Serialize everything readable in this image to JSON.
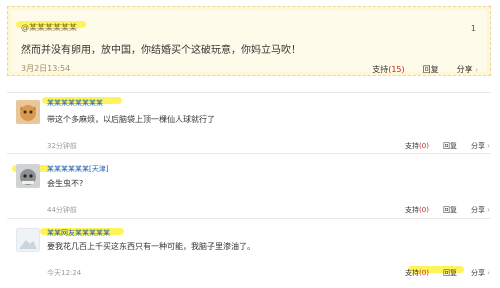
{
  "quote": {
    "author": "@某某某某某某",
    "number": "1",
    "text": "然而并没有卵用，放中国，你结婚买个这破玩意，你妈立马吹！",
    "time": "3月2日13:54",
    "actions": {
      "support": "支持",
      "support_count": "(15)",
      "reply": "回复",
      "share": "分享"
    }
  },
  "comments": [
    {
      "user": "某某某某某某某某",
      "text": "带这个多麻烦，以后脑袋上顶一棵仙人球就行了",
      "time": "32分钟前",
      "actions": {
        "support": "支持",
        "support_count": "(0)",
        "reply": "回复",
        "share": "分享"
      }
    },
    {
      "user": "某某某某某某[天津]",
      "text": "会生虫不?",
      "time": "44分钟前",
      "actions": {
        "support": "支持",
        "support_count": "(0)",
        "reply": "回复",
        "share": "分享"
      }
    },
    {
      "user": "某某网友某某某某某",
      "text": "要我花几百上千买这东西只有一种可能，我脑子里渗油了。",
      "time": "今天12:24",
      "actions": {
        "support": "支持",
        "support_count": "(0)",
        "reply": "回复",
        "share": "分享"
      }
    }
  ],
  "icons": {
    "share_arrow": "›"
  },
  "colors": {
    "count": "#c51f1f",
    "username": "#1d5fb0",
    "highlight": "#fff35a"
  }
}
